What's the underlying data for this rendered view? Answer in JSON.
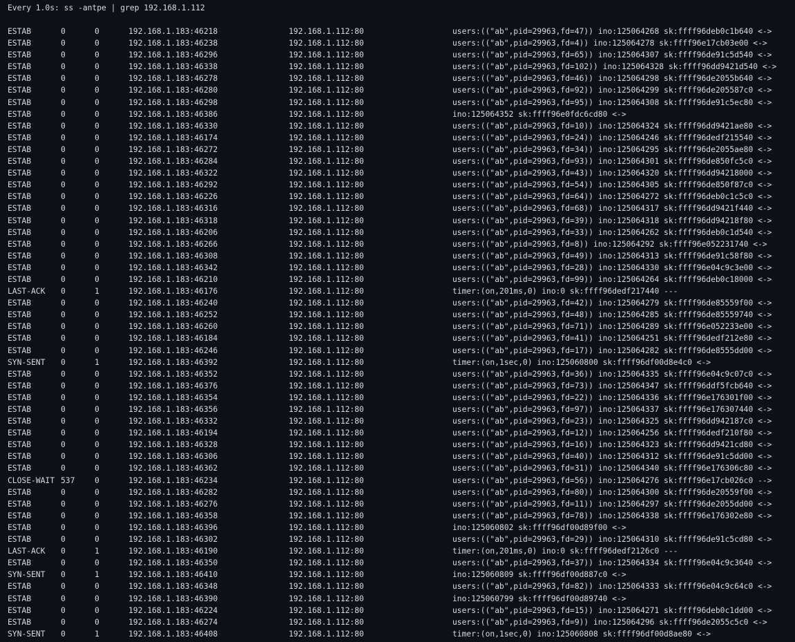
{
  "header": {
    "command_line": "Every 1.0s: ss -antpe | grep 192.168.1.112"
  },
  "rows": [
    {
      "state": "ESTAB",
      "recv_q": "0",
      "send_q": "0",
      "local": "192.168.1.183:46218",
      "peer": "192.168.1.112:80",
      "process": "users:((\"ab\",pid=29963,fd=47)) ino:125064268 sk:ffff96deb0c1b640 <->"
    },
    {
      "state": "ESTAB",
      "recv_q": "0",
      "send_q": "0",
      "local": "192.168.1.183:46238",
      "peer": "192.168.1.112:80",
      "process": "users:((\"ab\",pid=29963,fd=4)) ino:125064278 sk:ffff96e17cb03e00 <->"
    },
    {
      "state": "ESTAB",
      "recv_q": "0",
      "send_q": "0",
      "local": "192.168.1.183:46296",
      "peer": "192.168.1.112:80",
      "process": "users:((\"ab\",pid=29963,fd=65)) ino:125064307 sk:ffff96de91c5d540 <->"
    },
    {
      "state": "ESTAB",
      "recv_q": "0",
      "send_q": "0",
      "local": "192.168.1.183:46338",
      "peer": "192.168.1.112:80",
      "process": "users:((\"ab\",pid=29963,fd=102)) ino:125064328 sk:ffff96dd9421d540 <->"
    },
    {
      "state": "ESTAB",
      "recv_q": "0",
      "send_q": "0",
      "local": "192.168.1.183:46278",
      "peer": "192.168.1.112:80",
      "process": "users:((\"ab\",pid=29963,fd=46)) ino:125064298 sk:ffff96de2055b640 <->"
    },
    {
      "state": "ESTAB",
      "recv_q": "0",
      "send_q": "0",
      "local": "192.168.1.183:46280",
      "peer": "192.168.1.112:80",
      "process": "users:((\"ab\",pid=29963,fd=92)) ino:125064299 sk:ffff96de205587c0 <->"
    },
    {
      "state": "ESTAB",
      "recv_q": "0",
      "send_q": "0",
      "local": "192.168.1.183:46298",
      "peer": "192.168.1.112:80",
      "process": "users:((\"ab\",pid=29963,fd=95)) ino:125064308 sk:ffff96de91c5ec80 <->"
    },
    {
      "state": "ESTAB",
      "recv_q": "0",
      "send_q": "0",
      "local": "192.168.1.183:46386",
      "peer": "192.168.1.112:80",
      "process": "ino:125064352 sk:ffff96e0fdc6cd80 <->"
    },
    {
      "state": "ESTAB",
      "recv_q": "0",
      "send_q": "0",
      "local": "192.168.1.183:46330",
      "peer": "192.168.1.112:80",
      "process": "users:((\"ab\",pid=29963,fd=10)) ino:125064324 sk:ffff96dd9421ae80 <->"
    },
    {
      "state": "ESTAB",
      "recv_q": "0",
      "send_q": "0",
      "local": "192.168.1.183:46174",
      "peer": "192.168.1.112:80",
      "process": "users:((\"ab\",pid=29963,fd=24)) ino:125064246 sk:ffff96dedf215540 <->"
    },
    {
      "state": "ESTAB",
      "recv_q": "0",
      "send_q": "0",
      "local": "192.168.1.183:46272",
      "peer": "192.168.1.112:80",
      "process": "users:((\"ab\",pid=29963,fd=34)) ino:125064295 sk:ffff96de2055ae80 <->"
    },
    {
      "state": "ESTAB",
      "recv_q": "0",
      "send_q": "0",
      "local": "192.168.1.183:46284",
      "peer": "192.168.1.112:80",
      "process": "users:((\"ab\",pid=29963,fd=93)) ino:125064301 sk:ffff96de850fc5c0 <->"
    },
    {
      "state": "ESTAB",
      "recv_q": "0",
      "send_q": "0",
      "local": "192.168.1.183:46322",
      "peer": "192.168.1.112:80",
      "process": "users:((\"ab\",pid=29963,fd=43)) ino:125064320 sk:ffff96dd94218000 <->"
    },
    {
      "state": "ESTAB",
      "recv_q": "0",
      "send_q": "0",
      "local": "192.168.1.183:46292",
      "peer": "192.168.1.112:80",
      "process": "users:((\"ab\",pid=29963,fd=54)) ino:125064305 sk:ffff96de850f87c0 <->"
    },
    {
      "state": "ESTAB",
      "recv_q": "0",
      "send_q": "0",
      "local": "192.168.1.183:46226",
      "peer": "192.168.1.112:80",
      "process": "users:((\"ab\",pid=29963,fd=64)) ino:125064272 sk:ffff96deb0c1c5c0 <->"
    },
    {
      "state": "ESTAB",
      "recv_q": "0",
      "send_q": "0",
      "local": "192.168.1.183:46316",
      "peer": "192.168.1.112:80",
      "process": "users:((\"ab\",pid=29963,fd=68)) ino:125064317 sk:ffff96dd9421f440 <->"
    },
    {
      "state": "ESTAB",
      "recv_q": "0",
      "send_q": "0",
      "local": "192.168.1.183:46318",
      "peer": "192.168.1.112:80",
      "process": "users:((\"ab\",pid=29963,fd=39)) ino:125064318 sk:ffff96dd94218f80 <->"
    },
    {
      "state": "ESTAB",
      "recv_q": "0",
      "send_q": "0",
      "local": "192.168.1.183:46206",
      "peer": "192.168.1.112:80",
      "process": "users:((\"ab\",pid=29963,fd=33)) ino:125064262 sk:ffff96deb0c1d540 <->"
    },
    {
      "state": "ESTAB",
      "recv_q": "0",
      "send_q": "0",
      "local": "192.168.1.183:46266",
      "peer": "192.168.1.112:80",
      "process": "users:((\"ab\",pid=29963,fd=8)) ino:125064292 sk:ffff96e052231740 <->"
    },
    {
      "state": "ESTAB",
      "recv_q": "0",
      "send_q": "0",
      "local": "192.168.1.183:46308",
      "peer": "192.168.1.112:80",
      "process": "users:((\"ab\",pid=29963,fd=49)) ino:125064313 sk:ffff96de91c58f80 <->"
    },
    {
      "state": "ESTAB",
      "recv_q": "0",
      "send_q": "0",
      "local": "192.168.1.183:46342",
      "peer": "192.168.1.112:80",
      "process": "users:((\"ab\",pid=29963,fd=28)) ino:125064330 sk:ffff96e04c9c3e00 <->"
    },
    {
      "state": "ESTAB",
      "recv_q": "0",
      "send_q": "0",
      "local": "192.168.1.183:46210",
      "peer": "192.168.1.112:80",
      "process": "users:((\"ab\",pid=29963,fd=99)) ino:125064264 sk:ffff96deb0c18000 <->"
    },
    {
      "state": "LAST-ACK",
      "recv_q": "0",
      "send_q": "1",
      "local": "192.168.1.183:46176",
      "peer": "192.168.1.112:80",
      "process": "timer:(on,201ms,0) ino:0 sk:ffff96dedf217440 ---"
    },
    {
      "state": "ESTAB",
      "recv_q": "0",
      "send_q": "0",
      "local": "192.168.1.183:46240",
      "peer": "192.168.1.112:80",
      "process": "users:((\"ab\",pid=29963,fd=42)) ino:125064279 sk:ffff96de85559f00 <->"
    },
    {
      "state": "ESTAB",
      "recv_q": "0",
      "send_q": "0",
      "local": "192.168.1.183:46252",
      "peer": "192.168.1.112:80",
      "process": "users:((\"ab\",pid=29963,fd=48)) ino:125064285 sk:ffff96de85559740 <->"
    },
    {
      "state": "ESTAB",
      "recv_q": "0",
      "send_q": "0",
      "local": "192.168.1.183:46260",
      "peer": "192.168.1.112:80",
      "process": "users:((\"ab\",pid=29963,fd=71)) ino:125064289 sk:ffff96e052233e00 <->"
    },
    {
      "state": "ESTAB",
      "recv_q": "0",
      "send_q": "0",
      "local": "192.168.1.183:46184",
      "peer": "192.168.1.112:80",
      "process": "users:((\"ab\",pid=29963,fd=41)) ino:125064251 sk:ffff96dedf212e80 <->"
    },
    {
      "state": "ESTAB",
      "recv_q": "0",
      "send_q": "0",
      "local": "192.168.1.183:46246",
      "peer": "192.168.1.112:80",
      "process": "users:((\"ab\",pid=29963,fd=17)) ino:125064282 sk:ffff96de8555dd00 <->"
    },
    {
      "state": "SYN-SENT",
      "recv_q": "0",
      "send_q": "1",
      "local": "192.168.1.183:46392",
      "peer": "192.168.1.112:80",
      "process": "timer:(on,1sec,0) ino:125060800 sk:ffff96df00d8e4c0 <->"
    },
    {
      "state": "ESTAB",
      "recv_q": "0",
      "send_q": "0",
      "local": "192.168.1.183:46352",
      "peer": "192.168.1.112:80",
      "process": "users:((\"ab\",pid=29963,fd=36)) ino:125064335 sk:ffff96e04c9c07c0 <->"
    },
    {
      "state": "ESTAB",
      "recv_q": "0",
      "send_q": "0",
      "local": "192.168.1.183:46376",
      "peer": "192.168.1.112:80",
      "process": "users:((\"ab\",pid=29963,fd=73)) ino:125064347 sk:ffff96ddf5fcb640 <->"
    },
    {
      "state": "ESTAB",
      "recv_q": "0",
      "send_q": "0",
      "local": "192.168.1.183:46354",
      "peer": "192.168.1.112:80",
      "process": "users:((\"ab\",pid=29963,fd=22)) ino:125064336 sk:ffff96e176301f00 <->"
    },
    {
      "state": "ESTAB",
      "recv_q": "0",
      "send_q": "0",
      "local": "192.168.1.183:46356",
      "peer": "192.168.1.112:80",
      "process": "users:((\"ab\",pid=29963,fd=97)) ino:125064337 sk:ffff96e176307440 <->"
    },
    {
      "state": "ESTAB",
      "recv_q": "0",
      "send_q": "0",
      "local": "192.168.1.183:46332",
      "peer": "192.168.1.112:80",
      "process": "users:((\"ab\",pid=29963,fd=23)) ino:125064325 sk:ffff96dd942187c0 <->"
    },
    {
      "state": "ESTAB",
      "recv_q": "0",
      "send_q": "0",
      "local": "192.168.1.183:46194",
      "peer": "192.168.1.112:80",
      "process": "users:((\"ab\",pid=29963,fd=12)) ino:125064256 sk:ffff96dedf210f80 <->"
    },
    {
      "state": "ESTAB",
      "recv_q": "0",
      "send_q": "0",
      "local": "192.168.1.183:46328",
      "peer": "192.168.1.112:80",
      "process": "users:((\"ab\",pid=29963,fd=16)) ino:125064323 sk:ffff96dd9421cd80 <->"
    },
    {
      "state": "ESTAB",
      "recv_q": "0",
      "send_q": "0",
      "local": "192.168.1.183:46306",
      "peer": "192.168.1.112:80",
      "process": "users:((\"ab\",pid=29963,fd=40)) ino:125064312 sk:ffff96de91c5dd00 <->"
    },
    {
      "state": "ESTAB",
      "recv_q": "0",
      "send_q": "0",
      "local": "192.168.1.183:46362",
      "peer": "192.168.1.112:80",
      "process": "users:((\"ab\",pid=29963,fd=31)) ino:125064340 sk:ffff96e176306c80 <->"
    },
    {
      "state": "CLOSE-WAIT",
      "recv_q": "537",
      "send_q": "0",
      "local": "192.168.1.183:46234",
      "peer": "192.168.1.112:80",
      "process": "users:((\"ab\",pid=29963,fd=56)) ino:125064276 sk:ffff96e17cb026c0 -->"
    },
    {
      "state": "ESTAB",
      "recv_q": "0",
      "send_q": "0",
      "local": "192.168.1.183:46282",
      "peer": "192.168.1.112:80",
      "process": "users:((\"ab\",pid=29963,fd=80)) ino:125064300 sk:ffff96de20559f00 <->"
    },
    {
      "state": "ESTAB",
      "recv_q": "0",
      "send_q": "0",
      "local": "192.168.1.183:46276",
      "peer": "192.168.1.112:80",
      "process": "users:((\"ab\",pid=29963,fd=11)) ino:125064297 sk:ffff96de2055dd00 <->"
    },
    {
      "state": "ESTAB",
      "recv_q": "0",
      "send_q": "0",
      "local": "192.168.1.183:46358",
      "peer": "192.168.1.112:80",
      "process": "users:((\"ab\",pid=29963,fd=78)) ino:125064338 sk:ffff96e176302e80 <->"
    },
    {
      "state": "ESTAB",
      "recv_q": "0",
      "send_q": "0",
      "local": "192.168.1.183:46396",
      "peer": "192.168.1.112:80",
      "process": "ino:125060802 sk:ffff96df00d89f00 <->"
    },
    {
      "state": "ESTAB",
      "recv_q": "0",
      "send_q": "0",
      "local": "192.168.1.183:46302",
      "peer": "192.168.1.112:80",
      "process": "users:((\"ab\",pid=29963,fd=29)) ino:125064310 sk:ffff96de91c5cd80 <->"
    },
    {
      "state": "LAST-ACK",
      "recv_q": "0",
      "send_q": "1",
      "local": "192.168.1.183:46190",
      "peer": "192.168.1.112:80",
      "process": "timer:(on,201ms,0) ino:0 sk:ffff96dedf2126c0 ---"
    },
    {
      "state": "ESTAB",
      "recv_q": "0",
      "send_q": "0",
      "local": "192.168.1.183:46350",
      "peer": "192.168.1.112:80",
      "process": "users:((\"ab\",pid=29963,fd=37)) ino:125064334 sk:ffff96e04c9c3640 <->"
    },
    {
      "state": "SYN-SENT",
      "recv_q": "0",
      "send_q": "1",
      "local": "192.168.1.183:46410",
      "peer": "192.168.1.112:80",
      "process": "ino:125060809 sk:ffff96df00d887c0 <->"
    },
    {
      "state": "ESTAB",
      "recv_q": "0",
      "send_q": "0",
      "local": "192.168.1.183:46348",
      "peer": "192.168.1.112:80",
      "process": "users:((\"ab\",pid=29963,fd=82)) ino:125064333 sk:ffff96e04c9c64c0 <->"
    },
    {
      "state": "ESTAB",
      "recv_q": "0",
      "send_q": "0",
      "local": "192.168.1.183:46390",
      "peer": "192.168.1.112:80",
      "process": "ino:125060799 sk:ffff96df00d89740 <->"
    },
    {
      "state": "ESTAB",
      "recv_q": "0",
      "send_q": "0",
      "local": "192.168.1.183:46224",
      "peer": "192.168.1.112:80",
      "process": "users:((\"ab\",pid=29963,fd=15)) ino:125064271 sk:ffff96deb0c1dd00 <->"
    },
    {
      "state": "ESTAB",
      "recv_q": "0",
      "send_q": "0",
      "local": "192.168.1.183:46274",
      "peer": "192.168.1.112:80",
      "process": "users:((\"ab\",pid=29963,fd=9)) ino:125064296 sk:ffff96de2055c5c0 <->"
    },
    {
      "state": "SYN-SENT",
      "recv_q": "0",
      "send_q": "1",
      "local": "192.168.1.183:46408",
      "peer": "192.168.1.112:80",
      "process": "timer:(on,1sec,0) ino:125060808 sk:ffff96df00d8ae80 <->"
    }
  ]
}
